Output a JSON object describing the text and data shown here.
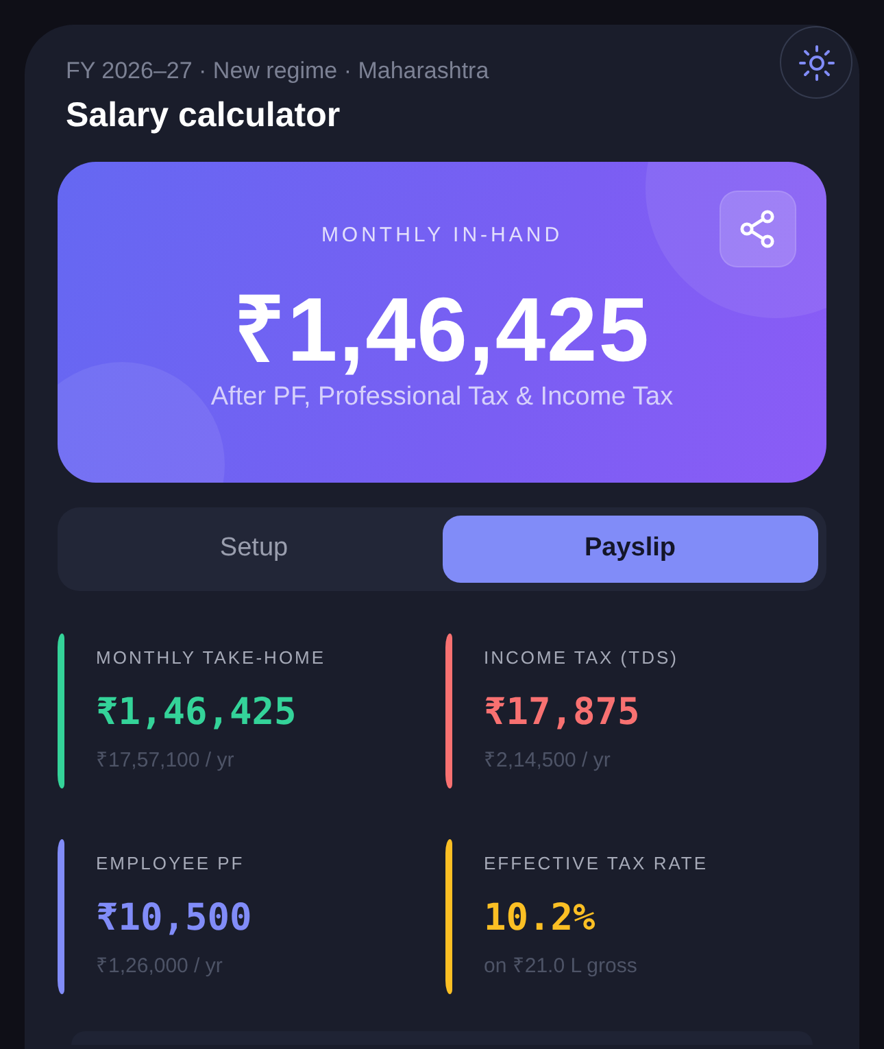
{
  "header": {
    "subtitle": "FY 2026–27 · New regime · Maharashtra",
    "title": "Salary calculator"
  },
  "hero": {
    "label": "MONTHLY IN-HAND",
    "amount": "₹1,46,425",
    "note": "After PF, Professional Tax & Income Tax"
  },
  "tabs": [
    {
      "label": "Setup",
      "selected": false
    },
    {
      "label": "Payslip",
      "selected": true
    }
  ],
  "stats": [
    {
      "label": "MONTHLY TAKE-HOME",
      "value": "₹1,46,425",
      "sub": "₹17,57,100 / yr",
      "color": "#34d399"
    },
    {
      "label": "INCOME TAX (TDS)",
      "value": "₹17,875",
      "sub": "₹2,14,500 / yr",
      "color": "#f87171"
    },
    {
      "label": "EMPLOYEE PF",
      "value": "₹10,500",
      "sub": "₹1,26,000 / yr",
      "color": "#818cf8"
    },
    {
      "label": "EFFECTIVE TAX RATE",
      "value": "10.2%",
      "sub": "on ₹21.0 L gross",
      "color": "#fbbf24"
    }
  ]
}
